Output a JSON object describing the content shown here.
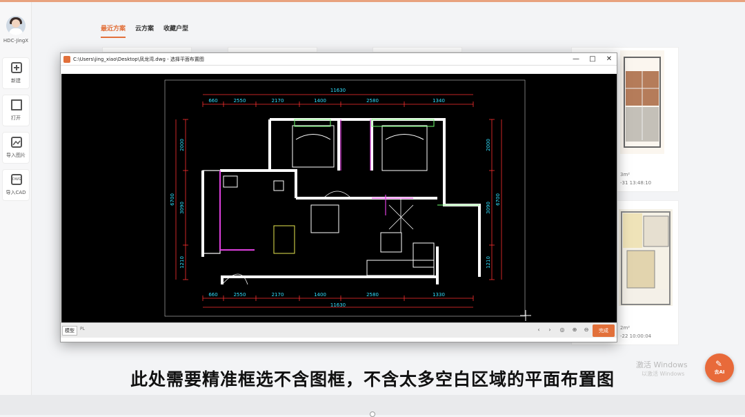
{
  "user": {
    "name": "HDC-JingX"
  },
  "sidebar": {
    "items": [
      {
        "label": "新建",
        "icon": "plus-icon"
      },
      {
        "label": "打开",
        "icon": "folder-icon"
      },
      {
        "label": "导入图片",
        "icon": "image-icon"
      },
      {
        "label": "导入CAD",
        "icon": "dwg-icon"
      }
    ]
  },
  "tabs": [
    {
      "label": "最近方案",
      "active": true
    },
    {
      "label": "云方案",
      "active": false
    },
    {
      "label": "收藏户型",
      "active": false
    }
  ],
  "cards": [
    {
      "meta1": "3m²",
      "meta2": "-31 13:48:10"
    },
    {
      "meta1": "2m²",
      "meta2": "-22 10:00:04"
    }
  ],
  "dialog": {
    "title": "C:\\Users\\jing_xiao\\Desktop\\凤龙湾.dwg - 选择平面布置图",
    "controls": {
      "minimize": "—",
      "maximize": "□",
      "close": "✕"
    },
    "status": {
      "model_tab": "模型",
      "layout_tab": "PL",
      "done_label": "完成",
      "nav_icons": [
        "prev-icon",
        "next-icon",
        "zoom-fit-icon",
        "zoom-in-icon",
        "zoom-out-icon"
      ]
    },
    "drawing": {
      "overall_width": "11630",
      "top_dims": [
        "660",
        "2550",
        "2170",
        "1400",
        "2580",
        "1340"
      ],
      "bottom_dims": [
        "660",
        "2550",
        "2170",
        "1400",
        "2580",
        "1330"
      ],
      "left_outer": "6700",
      "left_inner": [
        "2000",
        "3090",
        "1210"
      ],
      "right_outer": "6700",
      "right_inner": [
        "2000",
        "3090",
        "1210"
      ],
      "colors": {
        "dim": "#ff3030",
        "text": "#30e0ff",
        "wall": "#ffffff",
        "furniture": "#ffffff",
        "accent": "#e040e0",
        "green": "#70ff70",
        "yellow": "#e8e850"
      }
    }
  },
  "subtitle": "此处需要精准框选不含图框，不含太多空白区域的平面布置图",
  "watermark": {
    "line1": "激活 Windows",
    "line2": "以激活 Windows"
  },
  "ai_button": {
    "label": "去AI"
  },
  "accent_color": "#e2703a"
}
